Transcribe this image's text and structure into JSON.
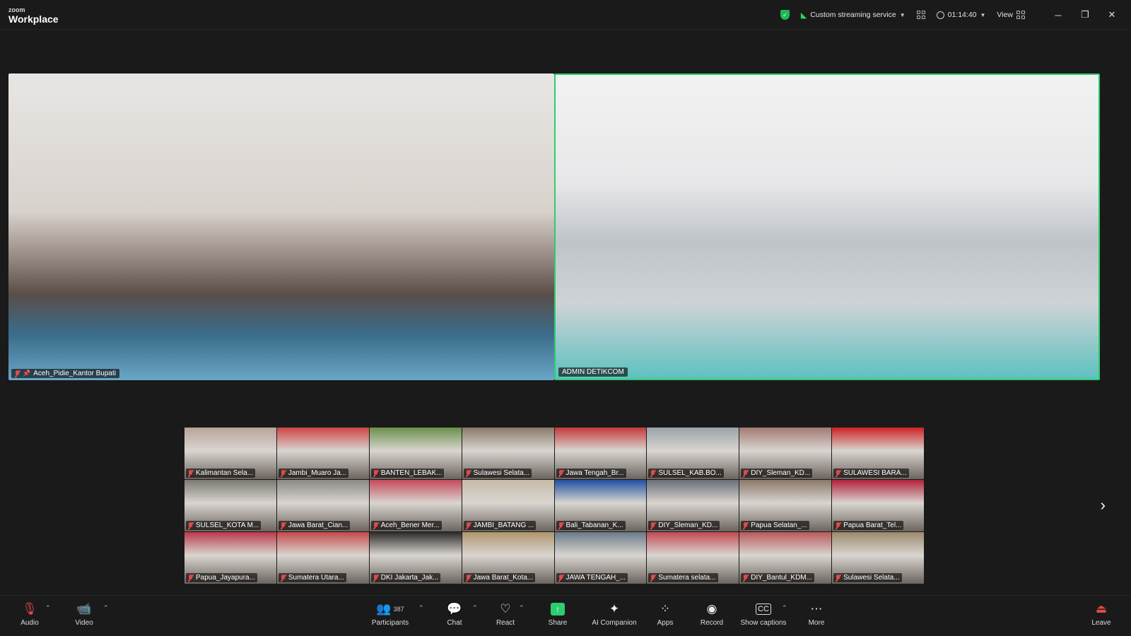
{
  "app": {
    "brand_small": "zoom",
    "brand_large": "Workplace"
  },
  "topbar": {
    "stream_label": "Custom streaming service",
    "timer": "01:14:40",
    "view_label": "View"
  },
  "main_speakers": [
    {
      "name": "Aceh_Pidie_Kantor Bupati",
      "pinned": true,
      "muted": true
    },
    {
      "name": "ADMIN DETIKCOM",
      "pinned": false,
      "muted": false,
      "active": true
    }
  ],
  "gallery": [
    {
      "name": "Kalimantan Sela...",
      "color": "#b8a49a"
    },
    {
      "name": "Jambi_Muaro Ja...",
      "color": "#c44"
    },
    {
      "name": "BANTEN_LEBAK...",
      "color": "#6a8f4a"
    },
    {
      "name": "Sulawesi Selata...",
      "color": "#8a7a6a"
    },
    {
      "name": "Jawa Tengah_Br...",
      "color": "#c33a3a"
    },
    {
      "name": "SULSEL_KAB.BO...",
      "color": "#9aa3a8"
    },
    {
      "name": "DIY_Sleman_KD...",
      "color": "#a47a74"
    },
    {
      "name": "SULAWESI BARA...",
      "color": "#c22"
    },
    {
      "name": "SULSEL_KOTA M...",
      "color": "#7c7872"
    },
    {
      "name": "Jawa Barat_Cian...",
      "color": "#8b8a86"
    },
    {
      "name": "Aceh_Bener Mer...",
      "color": "#c34a5a"
    },
    {
      "name": "JAMBI_BATANG ...",
      "color": "#c7bba8"
    },
    {
      "name": "Bali_Tabanan_K...",
      "color": "#2050a0"
    },
    {
      "name": "DIY_Sleman_KD...",
      "color": "#6a6e7a"
    },
    {
      "name": "Papua Selatan_...",
      "color": "#8a7868"
    },
    {
      "name": "Papua Barat_Tel...",
      "color": "#b0203a"
    },
    {
      "name": "Papua_Jayapura...",
      "color": "#b83a4a"
    },
    {
      "name": "Sumatera Utara...",
      "color": "#c44a4a"
    },
    {
      "name": "DKI Jakarta_Jak...",
      "color": "#2a2a2a"
    },
    {
      "name": "Jawa Barat_Kota...",
      "color": "#b0966e"
    },
    {
      "name": "JAWA TENGAH_...",
      "color": "#6a7a8a"
    },
    {
      "name": "Sumatera selata...",
      "color": "#c24a52"
    },
    {
      "name": "DIY_Bantul_KDM...",
      "color": "#b85a5a"
    },
    {
      "name": "Sulawesi Selata...",
      "color": "#9a8a6e"
    }
  ],
  "toolbar": {
    "audio": "Audio",
    "video": "Video",
    "participants": "Participants",
    "participant_count": "387",
    "chat": "Chat",
    "react": "React",
    "share": "Share",
    "ai": "AI Companion",
    "apps": "Apps",
    "record": "Record",
    "captions": "Show captions",
    "captions_icon": "CC",
    "more": "More",
    "leave": "Leave"
  }
}
